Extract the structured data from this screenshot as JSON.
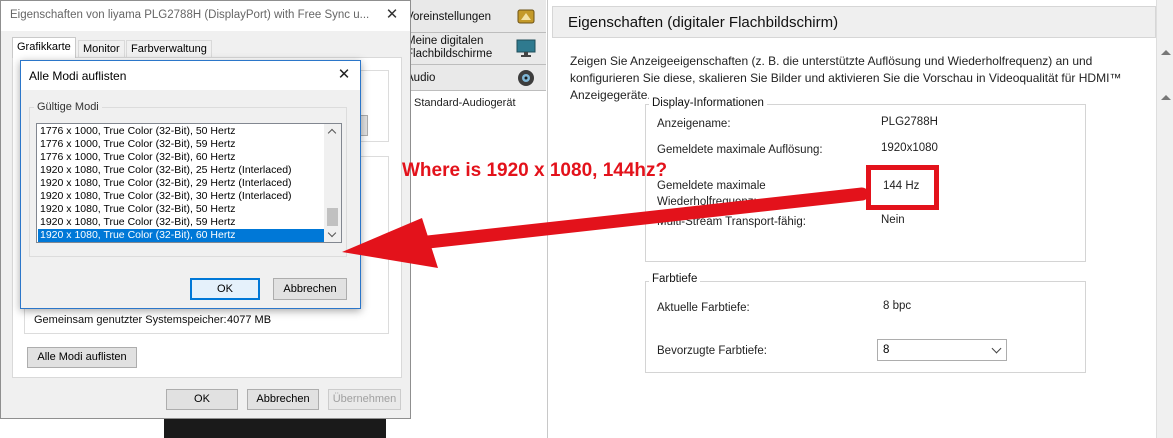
{
  "props_window": {
    "title": "Eigenschaften von liyama PLG2788H (DisplayPort) with Free Sync u...",
    "close_glyph": "✕",
    "tabs": [
      "Grafikkarte",
      "Monitor",
      "Farbverwaltung"
    ],
    "shared_memory_label": "Gemeinsam genutzter Systemspeicher:",
    "shared_memory_value": "4077 MB",
    "list_all_modes_label": "Alle Modi auflisten",
    "ok_label": "OK",
    "cancel_label": "Abbrechen",
    "apply_label": "Übernehmen"
  },
  "modes_dialog": {
    "title": "Alle Modi auflisten",
    "close_glyph": "✕",
    "group_title": "Gültige Modi",
    "modes": [
      "1776 x 1000, True Color (32-Bit), 50 Hertz",
      "1776 x 1000, True Color (32-Bit), 59 Hertz",
      "1776 x 1000, True Color (32-Bit), 60 Hertz",
      "1920 x 1080, True Color (32-Bit), 25 Hertz (Interlaced)",
      "1920 x 1080, True Color (32-Bit), 29 Hertz (Interlaced)",
      "1920 x 1080, True Color (32-Bit), 30 Hertz (Interlaced)",
      "1920 x 1080, True Color (32-Bit), 50 Hertz",
      "1920 x 1080, True Color (32-Bit), 59 Hertz",
      "1920 x 1080, True Color (32-Bit), 60 Hertz"
    ],
    "selected_index": 8,
    "ok_label": "OK",
    "cancel_label": "Abbrechen"
  },
  "nav": {
    "items": [
      "Voreinstellungen",
      "Meine digitalen\nFlachbildschirme",
      "Audio"
    ],
    "subitem": "Standard-Audiogerät"
  },
  "right_panel": {
    "title": "Eigenschaften (digitaler Flachbildschirm)",
    "description": "Zeigen Sie Anzeigeeigenschaften (z. B. die unterstützte Auflösung und Wiederholfrequenz) an und konfigurieren Sie diese, skalieren Sie Bilder und aktivieren Sie die Vorschau in Videoqualität für HDMI™ Anzeigegeräte.",
    "display_info": {
      "title": "Display-Informationen",
      "rows": [
        {
          "label": "Anzeigename:",
          "value": "PLG2788H"
        },
        {
          "label": "Gemeldete maximale Auflösung:",
          "value": "1920x1080"
        },
        {
          "label": "Gemeldete maximale\nWiederholfrequenz:",
          "value": "144 Hz"
        },
        {
          "label": "Multi-Stream Transport-fähig:",
          "value": "Nein"
        }
      ]
    },
    "color_depth": {
      "title": "Farbtiefe",
      "current_label": "Aktuelle Farbtiefe:",
      "current_value": "8 bpc",
      "preferred_label": "Bevorzugte Farbtiefe:",
      "preferred_value": "8"
    }
  },
  "annotation": {
    "text": "Where is 1920 x 1080, 144hz?",
    "color": "#e3121b"
  }
}
